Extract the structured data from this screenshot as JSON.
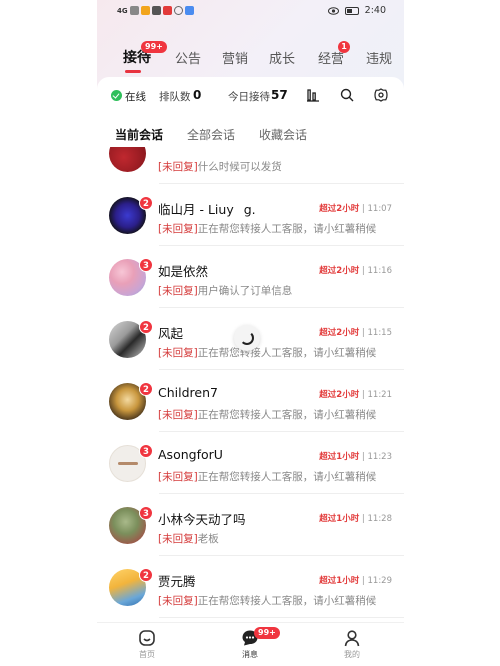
{
  "status_bar": {
    "time": "2:40",
    "signal_text": "4G"
  },
  "tabs": [
    {
      "label": "接待",
      "active": true,
      "badge": "99+"
    },
    {
      "label": "公告"
    },
    {
      "label": "营销"
    },
    {
      "label": "成长"
    },
    {
      "label": "经营",
      "badge": "1"
    },
    {
      "label": "违规"
    }
  ],
  "toolbar": {
    "online_label": "在线",
    "queue_label": "排队数",
    "queue_count": "0",
    "today_label": "今日接待",
    "today_count": "57"
  },
  "subtabs": [
    {
      "label": "当前会话",
      "active": true
    },
    {
      "label": "全部会话"
    },
    {
      "label": "收藏会话"
    }
  ],
  "conversations": [
    {
      "name": "",
      "badge": "",
      "overtime": "",
      "time": "",
      "tag": "[未回复]",
      "message": "什么时候可以发货"
    },
    {
      "name": "临山月 - Liuy    g.",
      "badge": "2",
      "overtime": "超过2小时",
      "time": "11:07",
      "tag": "[未回复]",
      "message": "正在帮您转接人工客服，请小红薯稍候"
    },
    {
      "name": "如是依然",
      "badge": "3",
      "overtime": "超过2小时",
      "time": "11:16",
      "tag": "[未回复]",
      "message": "用户确认了订单信息"
    },
    {
      "name": "风起",
      "badge": "2",
      "overtime": "超过2小时",
      "time": "11:15",
      "tag": "[未回复]",
      "message": "正在帮您转接人工客服，请小红薯稍候"
    },
    {
      "name": "Children7",
      "badge": "2",
      "overtime": "超过2小时",
      "time": "11:21",
      "tag": "[未回复]",
      "message": "正在帮您转接人工客服，请小红薯稍候"
    },
    {
      "name": "AsongforU",
      "badge": "3",
      "overtime": "超过1小时",
      "time": "11:23",
      "tag": "[未回复]",
      "message": "正在帮您转接人工客服，请小红薯稍候"
    },
    {
      "name": "小林今天动了吗",
      "badge": "3",
      "overtime": "超过1小时",
      "time": "11:28",
      "tag": "[未回复]",
      "message": "老板"
    },
    {
      "name": "贾元腾",
      "badge": "2",
      "overtime": "超过1小时",
      "time": "11:29",
      "tag": "[未回复]",
      "message": "正在帮您转接人工客服，请小红薯稍候"
    }
  ],
  "bottom_nav": [
    {
      "label": "首页",
      "icon": "home-icon"
    },
    {
      "label": "消息",
      "icon": "chat-icon",
      "active": true,
      "badge": "99+"
    },
    {
      "label": "我的",
      "icon": "profile-icon"
    }
  ],
  "colors": {
    "accent": "#f0353f",
    "online": "#2fbf5b",
    "overtime": "#e23a3a"
  }
}
